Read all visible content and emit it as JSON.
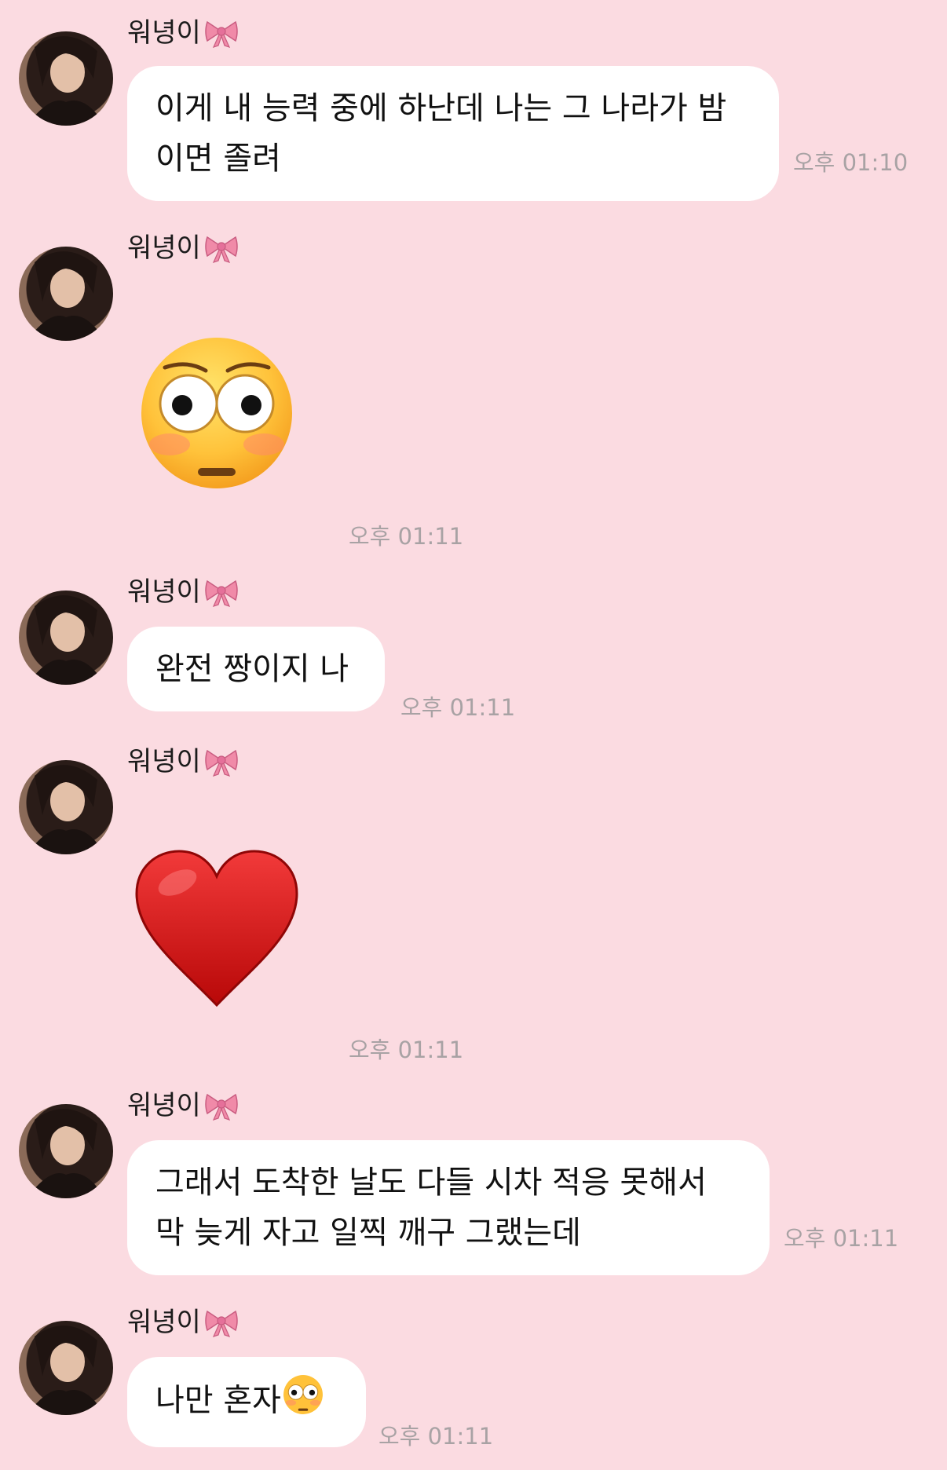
{
  "sender_name": "워녕이",
  "messages": [
    {
      "type": "text",
      "lines": [
        "이게 내 능력 중에 하난데 나는 그 나라가 밤",
        "이면 졸려"
      ],
      "time": "오후 01:10"
    },
    {
      "type": "emoji",
      "emoji": "flushed-face",
      "time": "오후 01:11"
    },
    {
      "type": "text",
      "lines": [
        "완전 짱이지 나"
      ],
      "time": "오후 01:11"
    },
    {
      "type": "emoji",
      "emoji": "red-heart",
      "time": "오후 01:11"
    },
    {
      "type": "text",
      "lines": [
        "그래서 도착한 날도 다들 시차 적응 못해서",
        "막 늦게 자고 일찍 깨구 그랬는데"
      ],
      "time": "오후 01:11"
    },
    {
      "type": "text",
      "lines": [
        "나만 혼자"
      ],
      "trailing_emoji": "flushed-face",
      "time": "오후 01:11"
    }
  ],
  "colors": {
    "background": "#fbdbe1",
    "bubble": "#ffffff",
    "timestamp": "#a8a2a4",
    "bow": "#f08aa8",
    "heart": "#d31414"
  }
}
